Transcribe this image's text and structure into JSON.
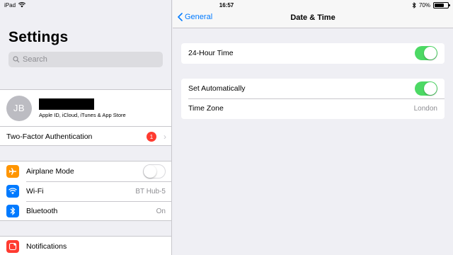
{
  "status_bar": {
    "device": "iPad",
    "time": "16:57",
    "battery_percent": "70%",
    "battery_level": 0.7
  },
  "sidebar": {
    "title": "Settings",
    "search_placeholder": "Search",
    "profile": {
      "initials": "JB",
      "subtitle": "Apple ID, iCloud, iTunes & App Store"
    },
    "two_factor": {
      "label": "Two-Factor Authentication",
      "badge": "1"
    },
    "items": [
      {
        "label": "Airplane Mode",
        "icon": "airplane-icon",
        "color": "#ff9500",
        "toggle": false
      },
      {
        "label": "Wi-Fi",
        "icon": "wifi-icon",
        "color": "#007aff",
        "value": "BT Hub-5"
      },
      {
        "label": "Bluetooth",
        "icon": "bluetooth-icon",
        "color": "#007aff",
        "value": "On"
      },
      {
        "label": "Notifications",
        "icon": "notifications-icon",
        "color": "#ff3b30"
      }
    ]
  },
  "detail": {
    "back_label": "General",
    "title": "Date & Time",
    "rows": {
      "twenty_four_hour": {
        "label": "24-Hour Time",
        "toggle": true
      },
      "set_automatically": {
        "label": "Set Automatically",
        "toggle": true
      },
      "time_zone": {
        "label": "Time Zone",
        "value": "London"
      }
    }
  },
  "colors": {
    "accent": "#007aff",
    "toggle_on": "#4cd964",
    "badge": "#ff3b30",
    "background": "#efeff4"
  }
}
